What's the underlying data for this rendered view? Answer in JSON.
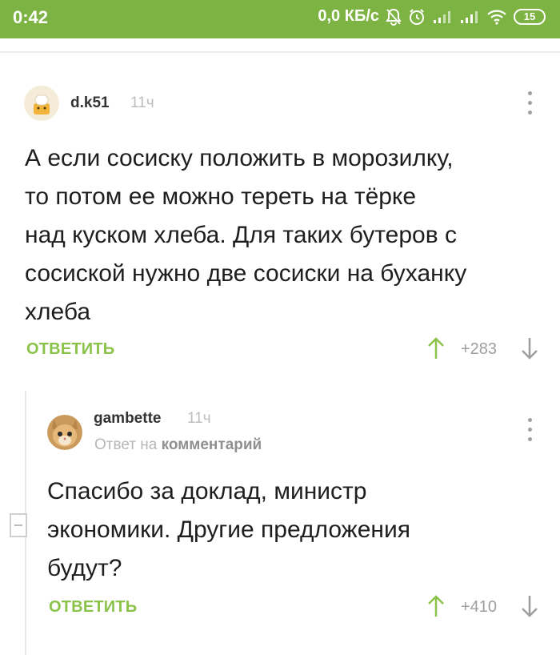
{
  "status_bar": {
    "time": "0:42",
    "network_speed": "0,0 КБ/с",
    "battery": "15",
    "color": "#7cb342"
  },
  "comments": [
    {
      "username": "d.k51",
      "time": "11ч",
      "text_lines": [
        "А если сосиску положить в морозилку,",
        "то потом ее можно тереть на тёрке",
        "над куском хлеба. Для таких бутеров с",
        "сосиской нужно две сосиски на буханку",
        "хлеба"
      ],
      "reply_label": "ОТВЕТИТЬ",
      "rating": "+283"
    },
    {
      "username": "gambette",
      "time": "11ч",
      "reply_to_prefix": "Ответ на",
      "reply_to_link": "комментарий",
      "text_lines": [
        "Спасибо за доклад, министр",
        "экономики. Другие предложения",
        "будут?"
      ],
      "reply_label": "ОТВЕТИТЬ",
      "rating": "+410"
    }
  ],
  "icons": {
    "upvote": "arrow-up-icon",
    "downvote": "arrow-down-icon",
    "menu": "more-vertical-icon",
    "collapse": "minus-square-icon"
  },
  "colors": {
    "accent": "#8bc34a",
    "upvote": "#8bc34a",
    "downvote": "#9e9e9e"
  }
}
